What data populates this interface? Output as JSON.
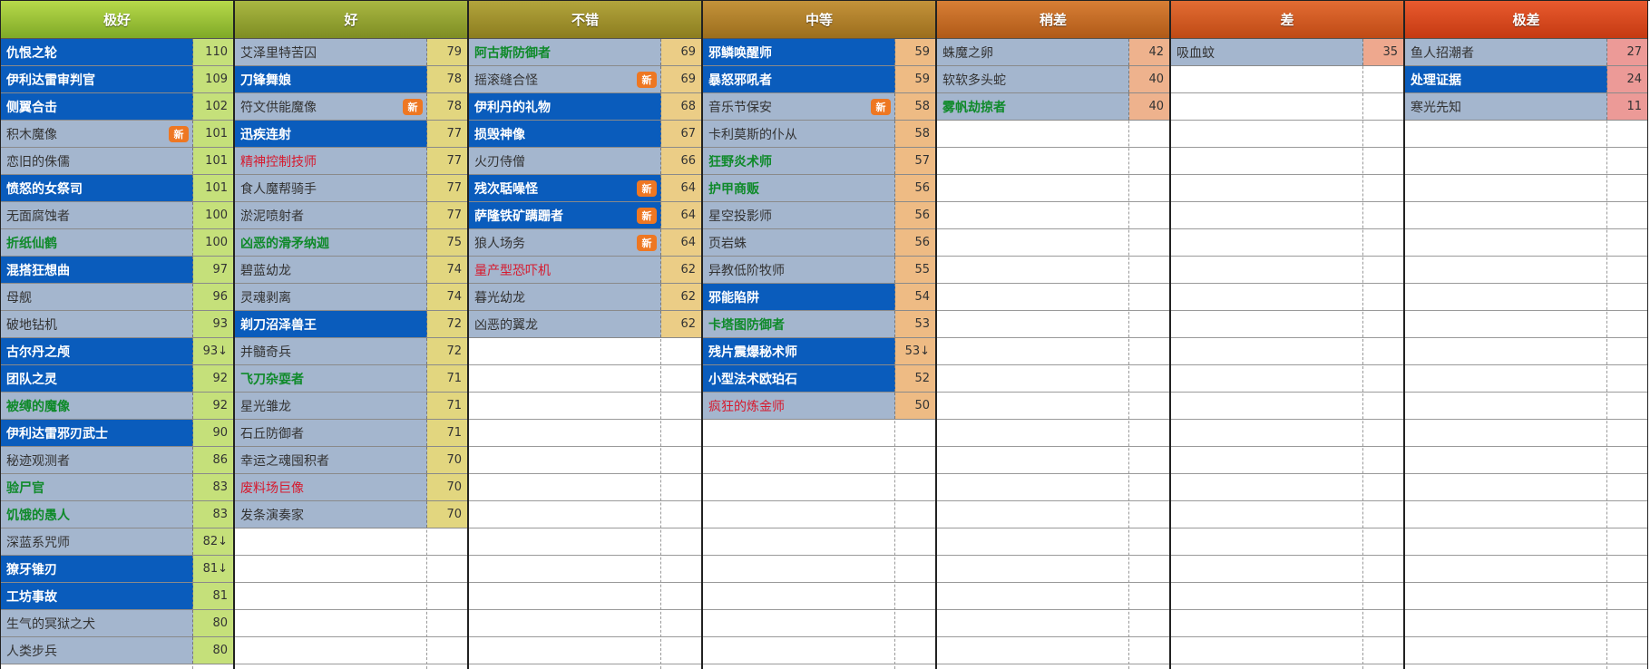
{
  "tiers": [
    {
      "label": "极好",
      "header_gradient": [
        "#b7d94a",
        "#7fa927"
      ],
      "score_color": "#c5e07a",
      "entries": [
        {
          "name": "仇恨之轮",
          "score": "110",
          "style": "blue",
          "badge": ""
        },
        {
          "name": "伊利达雷审判官",
          "score": "109",
          "style": "blue",
          "badge": ""
        },
        {
          "name": "侧翼合击",
          "score": "102",
          "style": "blue",
          "badge": ""
        },
        {
          "name": "积木魔像",
          "score": "101",
          "style": "gray",
          "badge": "新"
        },
        {
          "name": "恋旧的侏儒",
          "score": "101",
          "style": "gray",
          "badge": ""
        },
        {
          "name": "愤怒的女祭司",
          "score": "101",
          "style": "blue",
          "badge": ""
        },
        {
          "name": "无面腐蚀者",
          "score": "100",
          "style": "gray",
          "badge": ""
        },
        {
          "name": "折纸仙鹤",
          "score": "100",
          "style": "green",
          "badge": ""
        },
        {
          "name": "混搭狂想曲",
          "score": "97",
          "style": "blue",
          "badge": ""
        },
        {
          "name": "母舰",
          "score": "96",
          "style": "gray",
          "badge": ""
        },
        {
          "name": "破地钻机",
          "score": "93",
          "style": "gray",
          "badge": ""
        },
        {
          "name": "古尔丹之颅",
          "score": "93↓",
          "style": "blue",
          "badge": ""
        },
        {
          "name": "团队之灵",
          "score": "92",
          "style": "blue",
          "badge": ""
        },
        {
          "name": "被缚的魔像",
          "score": "92",
          "style": "green",
          "badge": ""
        },
        {
          "name": "伊利达雷邪刃武士",
          "score": "90",
          "style": "blue",
          "badge": ""
        },
        {
          "name": "秘迹观测者",
          "score": "86",
          "style": "gray",
          "badge": ""
        },
        {
          "name": "验尸官",
          "score": "83",
          "style": "green",
          "badge": ""
        },
        {
          "name": "饥饿的愚人",
          "score": "83",
          "style": "green",
          "badge": ""
        },
        {
          "name": "深蓝系咒师",
          "score": "82↓",
          "style": "gray",
          "badge": ""
        },
        {
          "name": "獠牙锥刃",
          "score": "81↓",
          "style": "blue",
          "badge": ""
        },
        {
          "name": "工坊事故",
          "score": "81",
          "style": "blue",
          "badge": ""
        },
        {
          "name": "生气的冥狱之犬",
          "score": "80",
          "style": "gray",
          "badge": ""
        },
        {
          "name": "人类步兵",
          "score": "80",
          "style": "gray",
          "badge": ""
        }
      ]
    },
    {
      "label": "好",
      "header_gradient": [
        "#a9b742",
        "#7e8d23"
      ],
      "score_color": "#e2d67f",
      "entries": [
        {
          "name": "艾泽里特苦囚",
          "score": "79",
          "style": "gray",
          "badge": ""
        },
        {
          "name": "刀锋舞娘",
          "score": "78",
          "style": "blue",
          "badge": ""
        },
        {
          "name": "符文供能魔像",
          "score": "78",
          "style": "gray",
          "badge": "新"
        },
        {
          "name": "迅疾连射",
          "score": "77",
          "style": "blue",
          "badge": ""
        },
        {
          "name": "精神控制技师",
          "score": "77",
          "style": "red",
          "badge": ""
        },
        {
          "name": "食人魔帮骑手",
          "score": "77",
          "style": "gray",
          "badge": ""
        },
        {
          "name": "淤泥喷射者",
          "score": "77",
          "style": "gray",
          "badge": ""
        },
        {
          "name": "凶恶的滑矛纳迦",
          "score": "75",
          "style": "green",
          "badge": ""
        },
        {
          "name": "碧蓝幼龙",
          "score": "74",
          "style": "gray",
          "badge": ""
        },
        {
          "name": "灵魂剥离",
          "score": "74",
          "style": "gray",
          "badge": ""
        },
        {
          "name": "剃刀沼泽兽王",
          "score": "72",
          "style": "blue",
          "badge": ""
        },
        {
          "name": "并髓奇兵",
          "score": "72",
          "style": "gray",
          "badge": ""
        },
        {
          "name": "飞刀杂耍者",
          "score": "71",
          "style": "green",
          "badge": ""
        },
        {
          "name": "星光雏龙",
          "score": "71",
          "style": "gray",
          "badge": ""
        },
        {
          "name": "石丘防御者",
          "score": "71",
          "style": "gray",
          "badge": ""
        },
        {
          "name": "幸运之魂囤积者",
          "score": "70",
          "style": "gray",
          "badge": ""
        },
        {
          "name": "废料场巨像",
          "score": "70",
          "style": "red",
          "badge": ""
        },
        {
          "name": "发条演奏家",
          "score": "70",
          "style": "gray",
          "badge": ""
        }
      ]
    },
    {
      "label": "不错",
      "header_gradient": [
        "#b2a43c",
        "#8c7d1f"
      ],
      "score_color": "#ebcd86",
      "entries": [
        {
          "name": "阿古斯防御者",
          "score": "69",
          "style": "green",
          "badge": ""
        },
        {
          "name": "摇滚缝合怪",
          "score": "69",
          "style": "gray",
          "badge": "新"
        },
        {
          "name": "伊利丹的礼物",
          "score": "68",
          "style": "blue",
          "badge": ""
        },
        {
          "name": "损毁神像",
          "score": "67",
          "style": "blue",
          "badge": ""
        },
        {
          "name": "火刃侍僧",
          "score": "66",
          "style": "gray",
          "badge": ""
        },
        {
          "name": "残次聒噪怪",
          "score": "64",
          "style": "blue",
          "badge": "新"
        },
        {
          "name": "萨隆铁矿蹒跚者",
          "score": "64",
          "style": "blue",
          "badge": "新"
        },
        {
          "name": "狼人场务",
          "score": "64",
          "style": "gray",
          "badge": "新"
        },
        {
          "name": "量产型恐吓机",
          "score": "62",
          "style": "red",
          "badge": ""
        },
        {
          "name": "暮光幼龙",
          "score": "62",
          "style": "gray",
          "badge": ""
        },
        {
          "name": "凶恶的翼龙",
          "score": "62",
          "style": "gray",
          "badge": ""
        }
      ]
    },
    {
      "label": "中等",
      "header_gradient": [
        "#c3923a",
        "#9c6e1d"
      ],
      "score_color": "#eebb84",
      "entries": [
        {
          "name": "邪鳞唤醒师",
          "score": "59",
          "style": "blue",
          "badge": ""
        },
        {
          "name": "暴怒邪吼者",
          "score": "59",
          "style": "blue",
          "badge": ""
        },
        {
          "name": "音乐节保安",
          "score": "58",
          "style": "gray",
          "badge": "新"
        },
        {
          "name": "卡利莫斯的仆从",
          "score": "58",
          "style": "gray",
          "badge": ""
        },
        {
          "name": "狂野炎术师",
          "score": "57",
          "style": "green",
          "badge": ""
        },
        {
          "name": "护甲商贩",
          "score": "56",
          "style": "green",
          "badge": ""
        },
        {
          "name": "星空投影师",
          "score": "56",
          "style": "gray",
          "badge": ""
        },
        {
          "name": "页岩蛛",
          "score": "56",
          "style": "gray",
          "badge": ""
        },
        {
          "name": "异教低阶牧师",
          "score": "55",
          "style": "gray",
          "badge": ""
        },
        {
          "name": "邪能陷阱",
          "score": "54",
          "style": "blue",
          "badge": ""
        },
        {
          "name": "卡塔图防御者",
          "score": "53",
          "style": "green",
          "badge": ""
        },
        {
          "name": "残片震爆秘术师",
          "score": "53↓",
          "style": "blue",
          "badge": ""
        },
        {
          "name": "小型法术欧珀石",
          "score": "52",
          "style": "blue",
          "badge": ""
        },
        {
          "name": "疯狂的炼金师",
          "score": "50",
          "style": "red",
          "badge": ""
        }
      ]
    },
    {
      "label": "稍差",
      "header_gradient": [
        "#d77e35",
        "#b05a18"
      ],
      "score_color": "#eeb28d",
      "entries": [
        {
          "name": "蛛魔之卵",
          "score": "42",
          "style": "gray",
          "badge": ""
        },
        {
          "name": "软软多头蛇",
          "score": "40",
          "style": "gray",
          "badge": ""
        },
        {
          "name": "雾帆劫掠者",
          "score": "40",
          "style": "green",
          "badge": ""
        }
      ]
    },
    {
      "label": "差",
      "header_gradient": [
        "#e26c33",
        "#bf4a15"
      ],
      "score_color": "#eea88e",
      "entries": [
        {
          "name": "吸血蚊",
          "score": "35",
          "style": "gray",
          "badge": ""
        }
      ]
    },
    {
      "label": "极差",
      "header_gradient": [
        "#e85a2e",
        "#c53a12"
      ],
      "score_color": "#ec9a97",
      "entries": [
        {
          "name": "鱼人招潮者",
          "score": "27",
          "style": "gray",
          "badge": ""
        },
        {
          "name": "处理证据",
          "score": "24",
          "style": "blue",
          "badge": ""
        },
        {
          "name": "寒光先知",
          "score": "11",
          "style": "gray",
          "badge": ""
        }
      ]
    }
  ]
}
